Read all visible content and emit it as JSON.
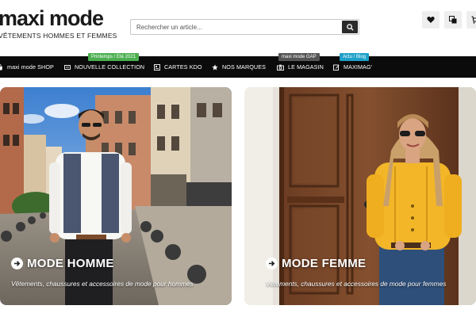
{
  "header": {
    "logo": "maxi mode",
    "tagline": "VÊTEMENTS HOMMES ET FEMMES",
    "search_placeholder": "Rechercher un article...",
    "icons": [
      "heart-icon",
      "compare-icon",
      "cart-icon"
    ]
  },
  "nav": {
    "items": [
      {
        "label": "maxi mode SHOP",
        "icon": "shop-icon"
      },
      {
        "label": "NOUVELLE COLLECTION",
        "icon": "new-icon",
        "badge": "Printemps / Eté 2021",
        "badge_color": "#4caf50"
      },
      {
        "label": "CARTES KDO",
        "icon": "gift-card-icon"
      },
      {
        "label": "NOS MARQUES",
        "icon": "star-icon"
      },
      {
        "label": "LE MAGASIN",
        "icon": "camera-icon",
        "badge": "maxi mode GAP",
        "badge_color": "#555555"
      },
      {
        "label": "MAXIMAG'",
        "icon": "edit-icon",
        "badge": "Actu / Blog",
        "badge_color": "#1ea0c8"
      }
    ]
  },
  "cards": [
    {
      "title": "MODE HOMME",
      "subtitle": "Vêtements, chaussures et accessoires de mode pour hommes"
    },
    {
      "title": "MODE FEMME",
      "subtitle": "Vêtements, chaussures et accessoires de mode pour femmes"
    }
  ],
  "colors": {
    "nav_bg": "#0b0b0b",
    "accent_dark": "#2b2b2b"
  }
}
